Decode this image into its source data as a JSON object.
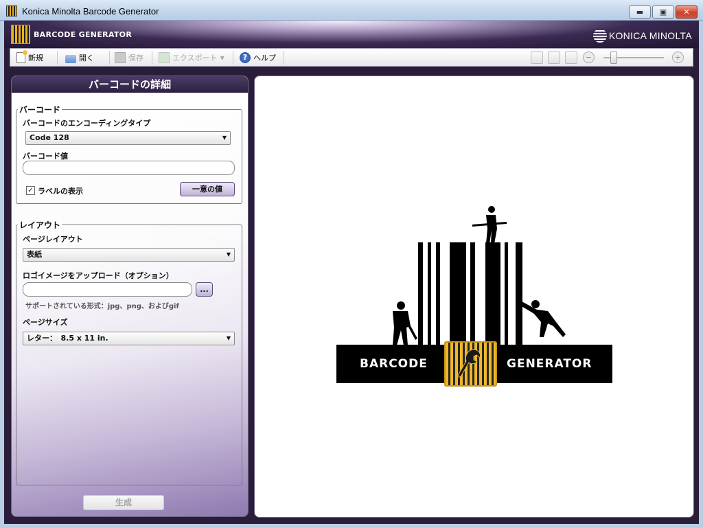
{
  "window": {
    "title": "Konica Minolta Barcode Generator",
    "minimize_label": "▬",
    "maximize_label": "▣",
    "close_label": "✕"
  },
  "header": {
    "app_name": "BARCODE GENERATOR",
    "brand": "KONICA MINOLTA"
  },
  "toolbar": {
    "new_label": "新規",
    "open_label": "開く",
    "save_label": "保存",
    "export_label": "エクスポート",
    "help_label": "ヘルプ",
    "zoom_out": "−",
    "zoom_in": "+"
  },
  "panel": {
    "title": "バーコードの詳細",
    "barcode_group": {
      "legend": "バーコード",
      "encoding_label": "バーコードのエンコーディングタイプ",
      "encoding_value": "Code 128",
      "value_label": "バーコード値",
      "value_text": "",
      "show_label_text": "ラベルの表示",
      "show_label_checked": true,
      "unique_button": "一意の値"
    },
    "layout_group": {
      "legend": "レイアウト",
      "page_layout_label": "ページレイアウト",
      "page_layout_value": "表紙",
      "logo_label": "ロゴイメージをアップロード（オプション）",
      "logo_path": "",
      "browse_label": "...",
      "supported_formats": "サポートされている形式：jpg、png、およびgif",
      "page_size_label": "ページサイズ",
      "page_size_value": "レター：　8.5 x 11 in."
    },
    "generate_button": "生成"
  },
  "preview": {
    "logo_left_text": "BARCODE",
    "logo_right_text": "GENERATOR"
  },
  "colors": {
    "accent_purple": "#2c2040",
    "logo_gold": "#f0b72a"
  }
}
